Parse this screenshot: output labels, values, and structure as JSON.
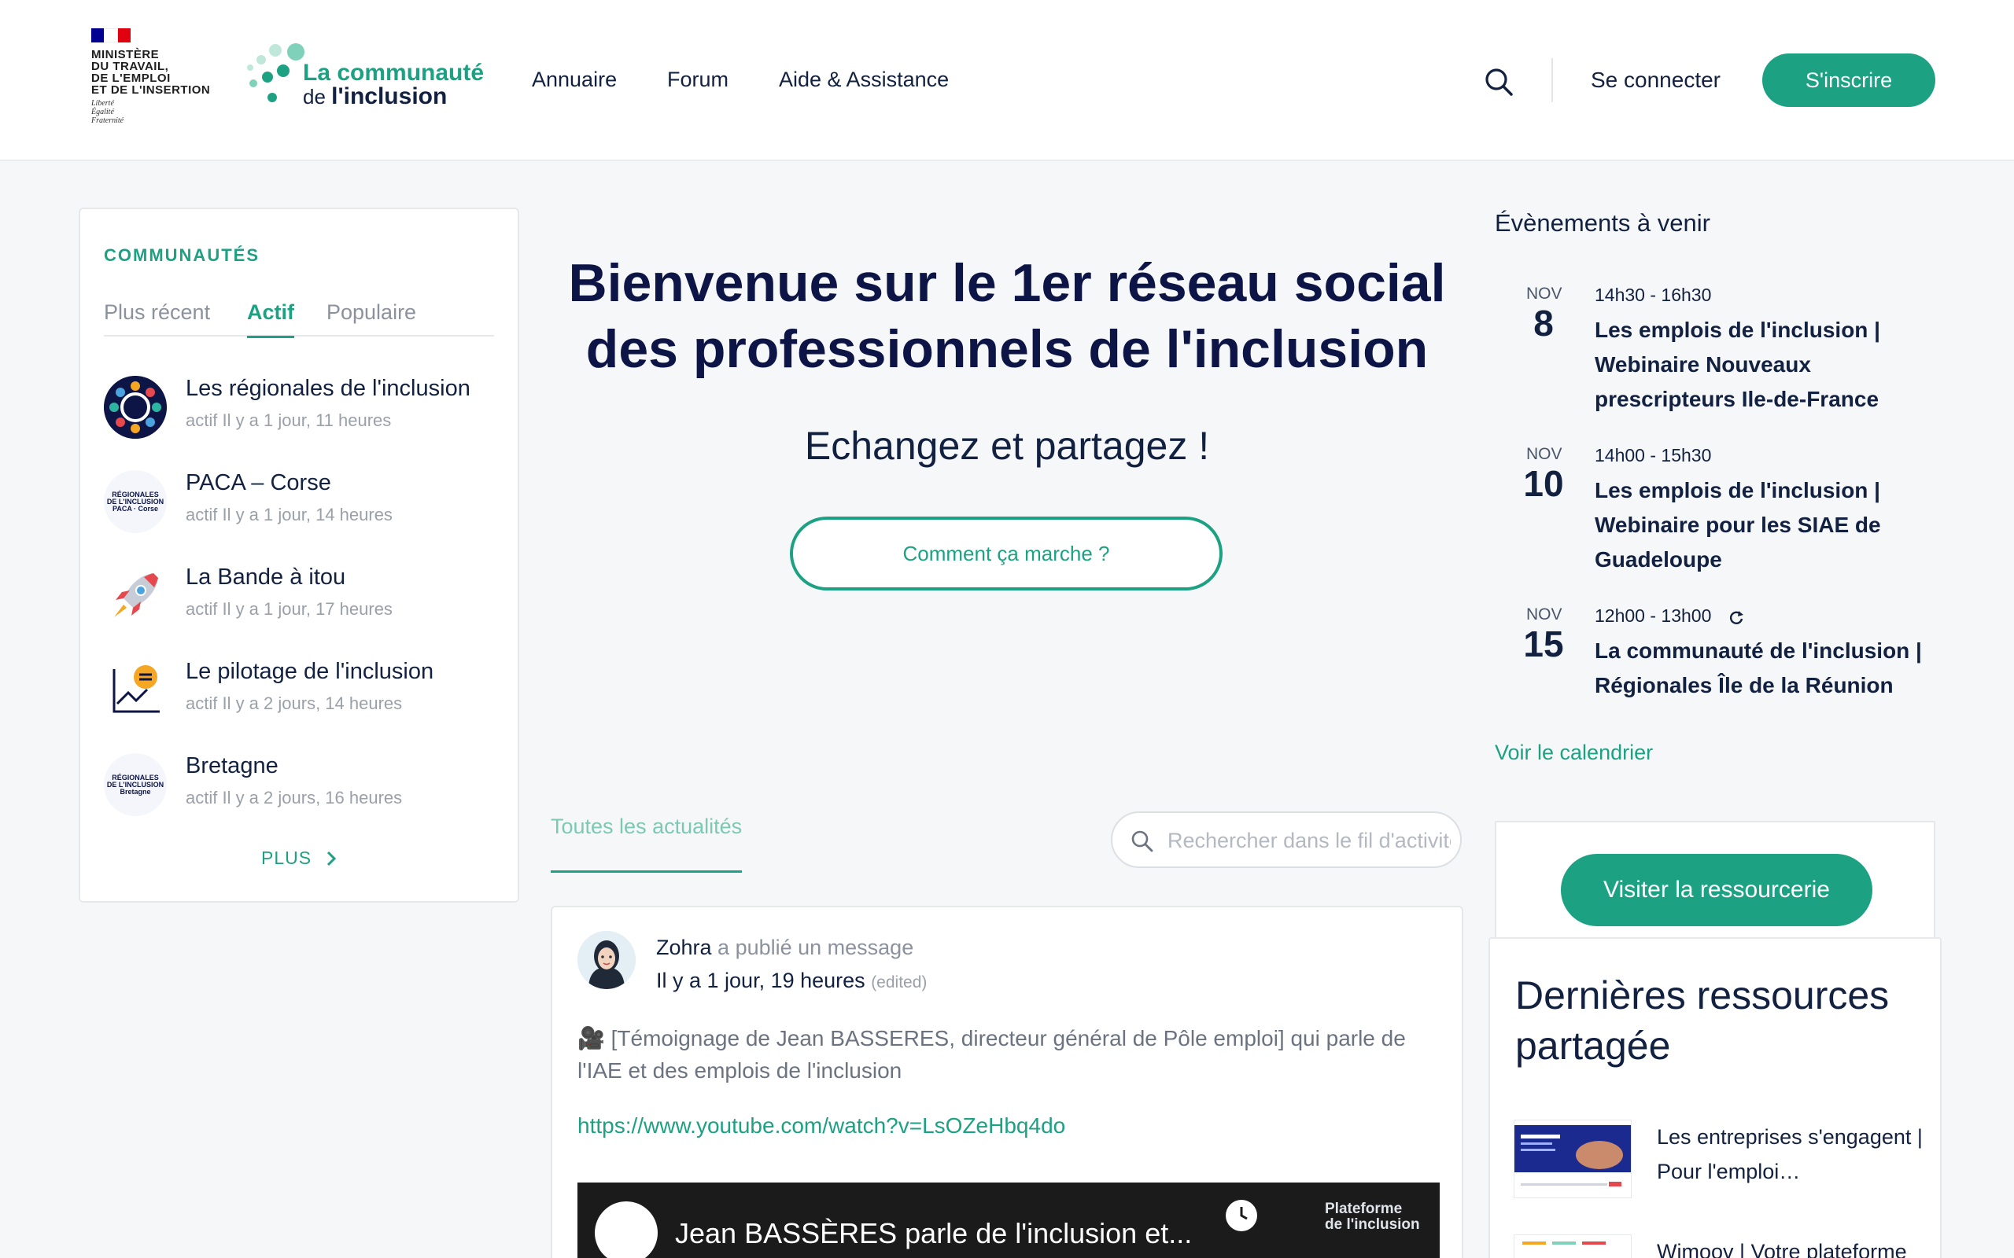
{
  "header": {
    "gov_name": "MINISTÈRE\nDU TRAVAIL,\nDE L'EMPLOI\nET DE L'INSERTION",
    "gov_motto": "Liberté\nÉgalité\nFraternité",
    "logo_line1": "La communauté",
    "logo_line2_prefix": "de ",
    "logo_line2_bold": "l'inclusion",
    "nav": [
      "Annuaire",
      "Forum",
      "Aide & Assistance"
    ],
    "login": "Se connecter",
    "signup": "S'inscrire",
    "colors": {
      "accent": "#1da183",
      "navy": "#0d1546"
    }
  },
  "communities": {
    "title": "COMMUNAUTÉS",
    "tabs": [
      "Plus récent",
      "Actif",
      "Populaire"
    ],
    "active_tab": "Actif",
    "groups": [
      {
        "name": "Les régionales de l'inclusion",
        "meta": "actif Il y a 1 jour, 11 heures",
        "icon": "regional-wheel-icon"
      },
      {
        "name": "PACA – Corse",
        "meta": "actif Il y a 1 jour, 14 heures",
        "icon": "regionales-paca-logo",
        "logo_text": "RÉGIONALES\nDE L'INCLUSION\nPACA · Corse"
      },
      {
        "name": "La Bande à itou",
        "meta": "actif Il y a 1 jour, 17 heures",
        "icon": "rocket-icon"
      },
      {
        "name": "Le pilotage de l'inclusion",
        "meta": "actif Il y a 2 jours, 14 heures",
        "icon": "chart-icon"
      },
      {
        "name": "Bretagne",
        "meta": "actif Il y a 2 jours, 16 heures",
        "icon": "regionales-bretagne-logo",
        "logo_text": "RÉGIONALES\nDE L'INCLUSION\nBretagne"
      }
    ],
    "more": "PLUS"
  },
  "hero": {
    "title": "Bienvenue sur le 1er réseau social des professionnels de l'inclusion",
    "subtitle": "Echangez et partagez !",
    "button": "Comment ça marche ?"
  },
  "feed": {
    "tab": "Toutes les actualités",
    "search_placeholder": "Rechercher dans le fil d'activité",
    "post": {
      "author": "Zohra",
      "action": " a publié un message",
      "time": "Il y a 1 jour, 19 heures",
      "edited": "(edited)",
      "text": "🎥 [Témoignage de Jean BASSERES, directeur général de Pôle emploi] qui parle de l'IAE et des emplois de l'inclusion",
      "link": "https://www.youtube.com/watch?v=LsOZeHbq4do",
      "video_title": "Jean BASSÈRES parle de l'inclusion et...",
      "video_brand": "Plateforme\nde l'inclusion"
    }
  },
  "events": {
    "title": "Évènements à venir",
    "items": [
      {
        "month": "NOV",
        "day": "8",
        "time": "14h30 - 16h30",
        "title": "Les emplois de l'inclusion | Webinaire Nouveaux prescripteurs Ile-de-France",
        "recurring": false
      },
      {
        "month": "NOV",
        "day": "10",
        "time": "14h00 - 15h30",
        "title": "Les emplois de l'inclusion | Webinaire pour les SIAE de Guadeloupe",
        "recurring": false
      },
      {
        "month": "NOV",
        "day": "15",
        "time": "12h00 - 13h00",
        "title": "La communauté de l'inclusion | Régionales Île de la Réunion",
        "recurring": true
      }
    ],
    "calendar_link": "Voir le calendrier"
  },
  "resources": {
    "button": "Visiter la ressourcerie",
    "title": "Dernières ressources partagée",
    "items": [
      {
        "title": "Les entreprises s'engagent | Pour l'emploi…"
      },
      {
        "title": "Wimoov | Votre plateforme"
      }
    ]
  }
}
